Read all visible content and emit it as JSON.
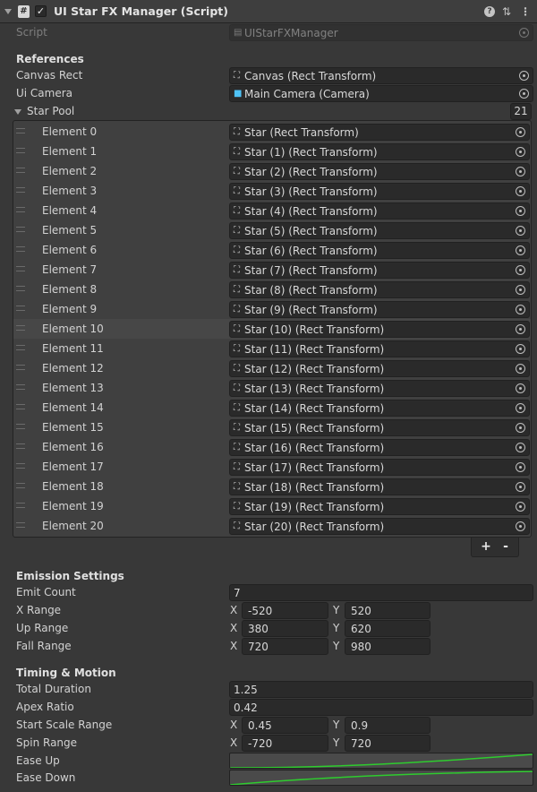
{
  "header": {
    "title": "UI Star FX Manager (Script)",
    "enabled": "✓",
    "help_glyph": "?",
    "settings_glyph": "⇅",
    "menu_glyph": "⋮"
  },
  "script_row": {
    "label": "Script",
    "value": "UIStarFXManager"
  },
  "references": {
    "heading": "References",
    "canvas_rect": {
      "label": "Canvas Rect",
      "value": "Canvas (Rect Transform)"
    },
    "ui_camera": {
      "label": "Ui Camera",
      "value": "Main Camera (Camera)"
    }
  },
  "star_pool": {
    "label": "Star Pool",
    "count": "21",
    "highlighted_index": 10,
    "elements": [
      {
        "label": "Element 0",
        "value": "Star (Rect Transform)"
      },
      {
        "label": "Element 1",
        "value": "Star (1) (Rect Transform)"
      },
      {
        "label": "Element 2",
        "value": "Star (2) (Rect Transform)"
      },
      {
        "label": "Element 3",
        "value": "Star (3) (Rect Transform)"
      },
      {
        "label": "Element 4",
        "value": "Star (4) (Rect Transform)"
      },
      {
        "label": "Element 5",
        "value": "Star (5) (Rect Transform)"
      },
      {
        "label": "Element 6",
        "value": "Star (6) (Rect Transform)"
      },
      {
        "label": "Element 7",
        "value": "Star (7) (Rect Transform)"
      },
      {
        "label": "Element 8",
        "value": "Star (8) (Rect Transform)"
      },
      {
        "label": "Element 9",
        "value": "Star (9) (Rect Transform)"
      },
      {
        "label": "Element 10",
        "value": "Star (10) (Rect Transform)"
      },
      {
        "label": "Element 11",
        "value": "Star (11) (Rect Transform)"
      },
      {
        "label": "Element 12",
        "value": "Star (12) (Rect Transform)"
      },
      {
        "label": "Element 13",
        "value": "Star (13) (Rect Transform)"
      },
      {
        "label": "Element 14",
        "value": "Star (14) (Rect Transform)"
      },
      {
        "label": "Element 15",
        "value": "Star (15) (Rect Transform)"
      },
      {
        "label": "Element 16",
        "value": "Star (16) (Rect Transform)"
      },
      {
        "label": "Element 17",
        "value": "Star (17) (Rect Transform)"
      },
      {
        "label": "Element 18",
        "value": "Star (18) (Rect Transform)"
      },
      {
        "label": "Element 19",
        "value": "Star (19) (Rect Transform)"
      },
      {
        "label": "Element 20",
        "value": "Star (20) (Rect Transform)"
      }
    ],
    "add_label": "+",
    "remove_label": "-"
  },
  "emission": {
    "heading": "Emission Settings",
    "emit_count": {
      "label": "Emit Count",
      "value": "7"
    },
    "x_range": {
      "label": "X Range",
      "x_axis": "X",
      "x": "-520",
      "y_axis": "Y",
      "y": "520"
    },
    "up_range": {
      "label": "Up Range",
      "x_axis": "X",
      "x": "380",
      "y_axis": "Y",
      "y": "620"
    },
    "fall_range": {
      "label": "Fall Range",
      "x_axis": "X",
      "x": "720",
      "y_axis": "Y",
      "y": "980"
    }
  },
  "timing": {
    "heading": "Timing & Motion",
    "total_duration": {
      "label": "Total Duration",
      "value": "1.25"
    },
    "apex_ratio": {
      "label": "Apex Ratio",
      "value": "0.42"
    },
    "start_scale_range": {
      "label": "Start Scale Range",
      "x_axis": "X",
      "x": "0.45",
      "y_axis": "Y",
      "y": "0.9"
    },
    "spin_range": {
      "label": "Spin Range",
      "x_axis": "X",
      "x": "-720",
      "y_axis": "Y",
      "y": "720"
    },
    "ease_up": {
      "label": "Ease Up"
    },
    "ease_down": {
      "label": "Ease Down"
    }
  },
  "colors": {
    "background": "#383838",
    "field": "#2a2a2a",
    "curve_line": "#2ecc2e",
    "camera_icon": "#4fc3f7"
  },
  "icons": {
    "rect_transform": "rect-transform-icon",
    "camera": "camera-icon",
    "object_picker": "object-picker-icon",
    "script_asset": "script-asset-icon"
  }
}
